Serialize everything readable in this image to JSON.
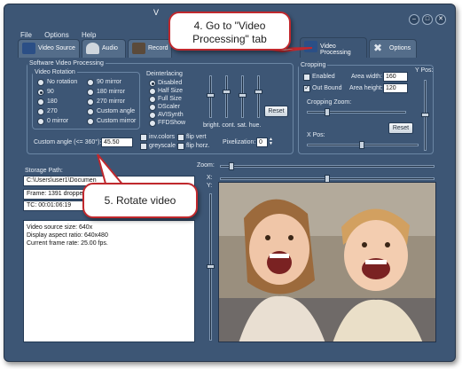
{
  "window": {
    "title": "V"
  },
  "menu": [
    "File",
    "Options",
    "Help"
  ],
  "tabs": [
    "Video Source",
    "Audio",
    "Record",
    "Video Processing",
    "Options"
  ],
  "software_processing": {
    "legend": "Software Video Processing",
    "rotation": {
      "legend": "Video Rotation",
      "options": [
        "No rotation",
        "90",
        "180",
        "270",
        "0 mirror",
        "90 mirror",
        "180 mirror",
        "270 mirror",
        "Custom angle",
        "Custom mirror"
      ],
      "selected": "90"
    },
    "deinterlacing": {
      "legend": "Deinterlacing",
      "options": [
        "Disabled",
        "Half Size",
        "Full Size",
        "DScaler",
        "AVISynth",
        "FFDShow"
      ],
      "selected": "Disabled"
    },
    "slider_labels": "bright. cont. sat. hue.",
    "reset_label": "Reset",
    "custom_angle_label": "Custom angle (<= 360°):",
    "custom_angle_value": "45.50",
    "checks": {
      "inv_colors": "inv.colors",
      "greyscale": "greyscale",
      "flip_vert": "flip vert",
      "flip_horz": "flip horz."
    },
    "pixelization_label": "Pixelization:",
    "pixelization_value": "0"
  },
  "cropping": {
    "legend": "Cropping",
    "enabled_label": "Enabled",
    "outbound_label": "Out Bound",
    "outbound_checked": true,
    "enabled_checked": false,
    "area_width_label": "Area width:",
    "area_width_value": "160",
    "area_height_label": "Area height:",
    "area_height_value": "120",
    "zoom_label": "Cropping Zoom:",
    "xpos_label": "X Pos:",
    "ypos_label": "Y Pos:",
    "reset_label": "Reset"
  },
  "storage": {
    "label": "Storage Path:",
    "path": "C:\\Users\\user1\\Documen",
    "frame": "Frame: 1391 dropped:",
    "tc": "TC: 00:01:06:19",
    "info": [
      "Video source size: 640x",
      "Display aspect ratio: 640x480",
      "Current frame rate: 25.00 fps."
    ]
  },
  "preview_controls": {
    "zoom": "Zoom:",
    "x": "X:",
    "y": "Y:"
  },
  "callouts": {
    "go_to_tab": "4. Go to \"Video Processing\" tab",
    "rotate": "5. Rotate video"
  }
}
